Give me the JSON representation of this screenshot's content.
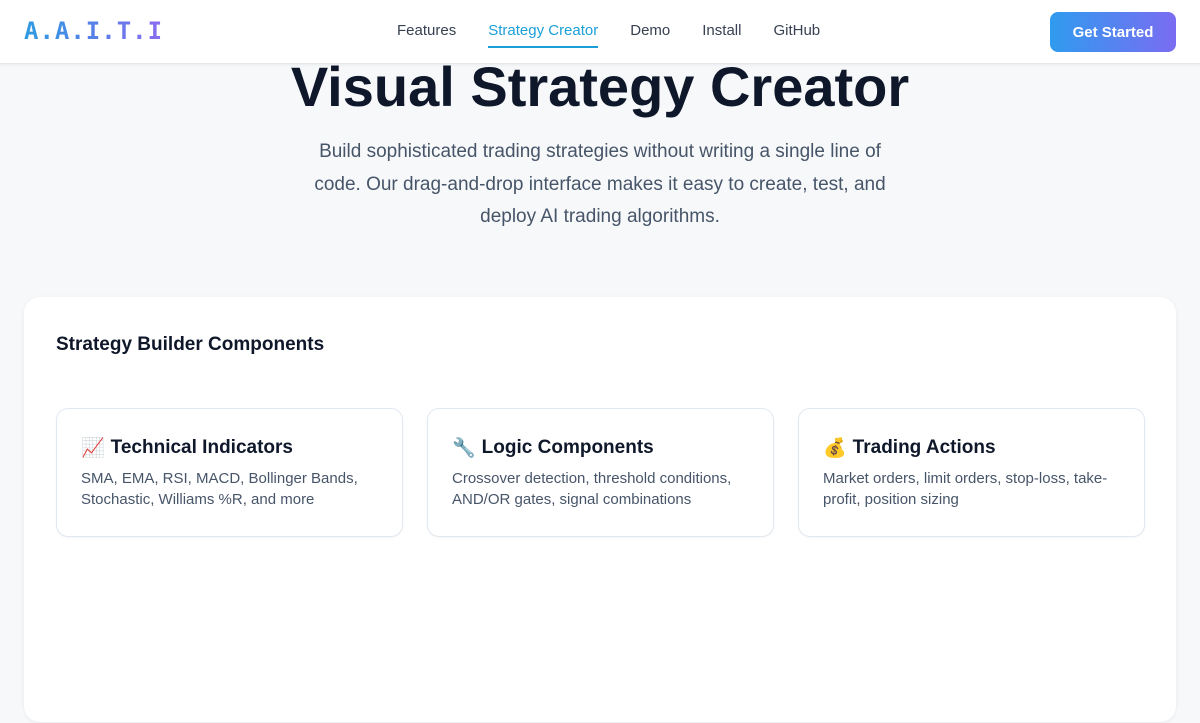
{
  "header": {
    "logo": "A.A.I.T.I",
    "nav": [
      {
        "label": "Features",
        "active": false
      },
      {
        "label": "Strategy Creator",
        "active": true
      },
      {
        "label": "Demo",
        "active": false
      },
      {
        "label": "Install",
        "active": false
      },
      {
        "label": "GitHub",
        "active": false
      }
    ],
    "cta_label": "Get Started"
  },
  "hero": {
    "title": "Visual Strategy Creator",
    "subtitle": "Build sophisticated trading strategies without writing a single line of code. Our drag-and-drop interface makes it easy to create, test, and deploy AI trading algorithms."
  },
  "builder": {
    "title": "Strategy Builder Components",
    "cards": [
      {
        "icon": "📈",
        "icon_name": "chart-increasing-icon",
        "title": "Technical Indicators",
        "description": "SMA, EMA, RSI, MACD, Bollinger Bands, Stochastic, Williams %R, and more"
      },
      {
        "icon": "🔧",
        "icon_name": "wrench-icon",
        "title": "Logic Components",
        "description": "Crossover detection, threshold conditions, AND/OR gates, signal combinations"
      },
      {
        "icon": "💰",
        "icon_name": "money-bag-icon",
        "title": "Trading Actions",
        "description": "Market orders, limit orders, stop-loss, take-profit, position sizing"
      }
    ]
  },
  "colors": {
    "accent": "#1a9fd8",
    "gradient_start": "#2f9bef",
    "gradient_end": "#7a6cf2",
    "heading": "#0f172a",
    "body_text": "#475569",
    "background": "#f7f8fa"
  }
}
